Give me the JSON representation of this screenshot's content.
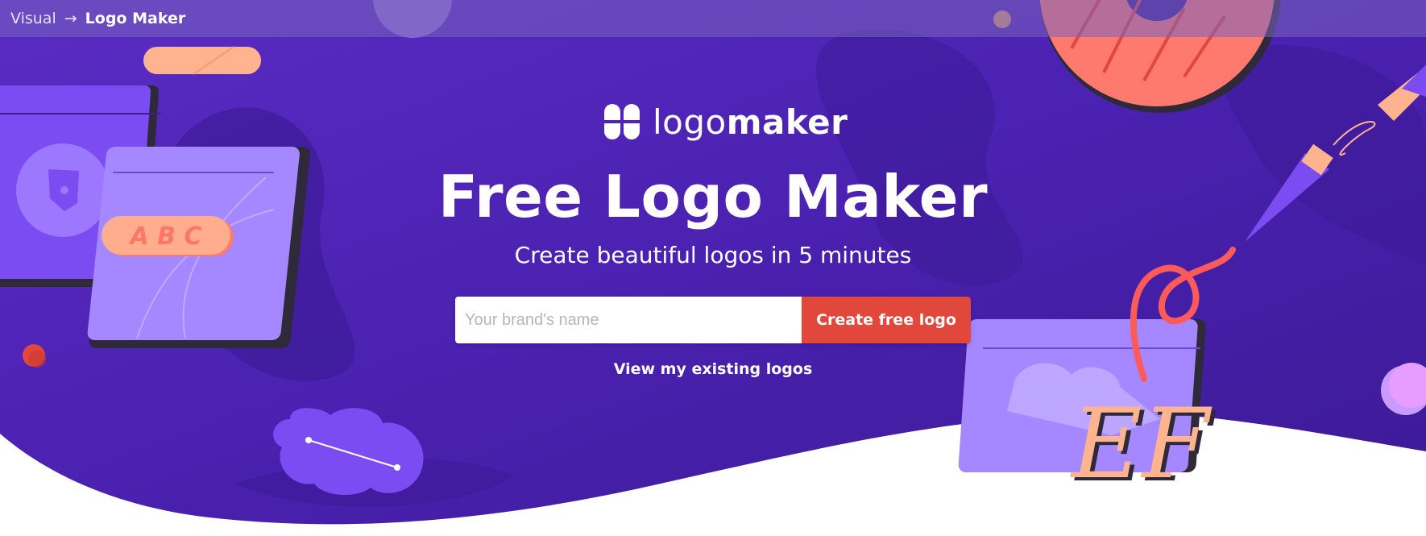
{
  "breadcrumb": {
    "parent": "Visual",
    "separator": "→",
    "current": "Logo Maker"
  },
  "brand": {
    "name_light": "logo",
    "name_bold": "maker",
    "icon": "logomaker-clover-icon"
  },
  "hero": {
    "title": "Free Logo Maker",
    "subtitle": "Create beautiful logos in 5 minutes",
    "input_placeholder": "Your brand's name",
    "cta_label": "Create free logo",
    "existing_link": "View my existing logos"
  },
  "decor": {
    "abc_label": "A B C",
    "ef_label": "EF"
  },
  "colors": {
    "hero_bg": "#4b22b0",
    "cta": "#e2473c",
    "accent_peach": "#ffb38f",
    "accent_coral": "#ff5a5a",
    "accent_lilac": "#9b78ff"
  }
}
